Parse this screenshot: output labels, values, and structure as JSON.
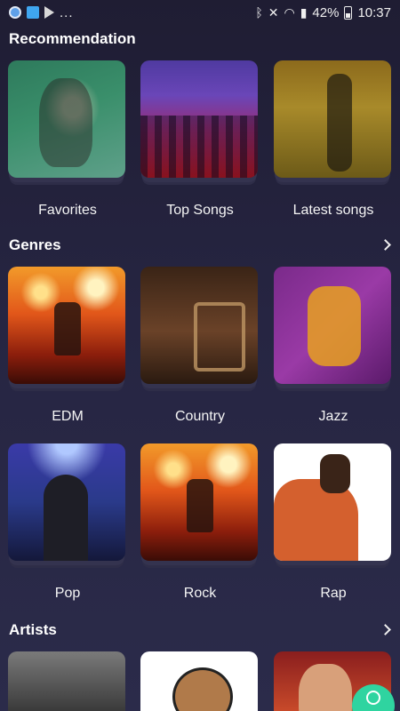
{
  "status_bar": {
    "left_dots": "...",
    "battery": "42%",
    "time": "10:37"
  },
  "sections": {
    "recommendation": {
      "title": "Recommendation",
      "items": [
        {
          "label": "Favorites"
        },
        {
          "label": "Top Songs"
        },
        {
          "label": "Latest songs"
        }
      ]
    },
    "genres": {
      "title": "Genres",
      "items": [
        {
          "label": "EDM"
        },
        {
          "label": "Country"
        },
        {
          "label": "Jazz"
        },
        {
          "label": "Pop"
        },
        {
          "label": "Rock"
        },
        {
          "label": "Rap"
        }
      ]
    },
    "artists": {
      "title": "Artists"
    }
  },
  "icons": {
    "more": "chevron-right-icon",
    "fab": "search-icon"
  },
  "colors": {
    "background": "#262542",
    "fab": "#2fd4a0"
  }
}
